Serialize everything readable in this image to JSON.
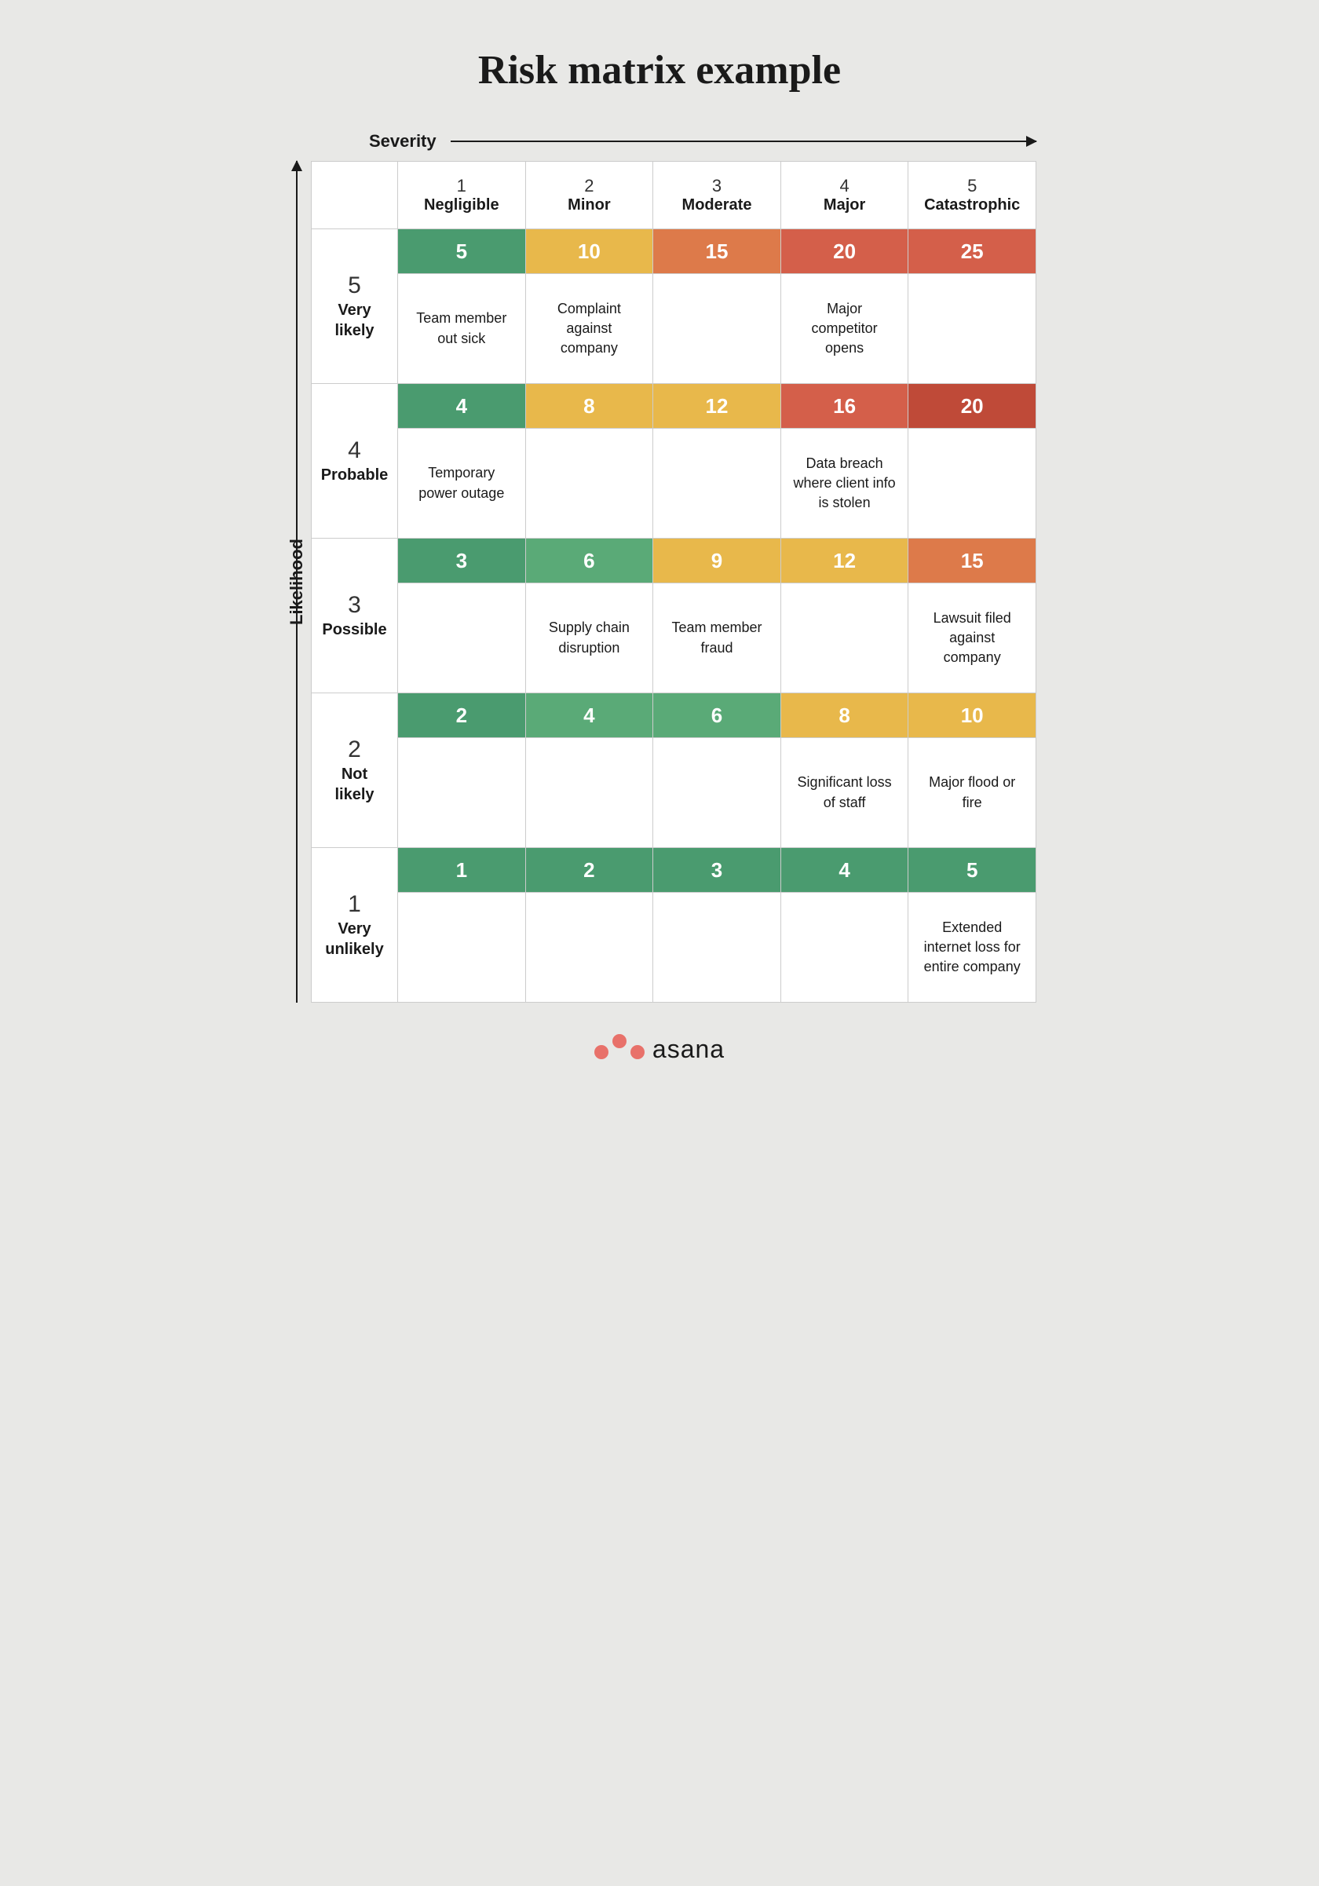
{
  "title": "Risk matrix example",
  "severity_label": "Severity",
  "likelihood_label": "Likelihood",
  "col_headers": [
    {
      "num": "1",
      "name": "Negligible"
    },
    {
      "num": "2",
      "name": "Minor"
    },
    {
      "num": "3",
      "name": "Moderate"
    },
    {
      "num": "4",
      "name": "Major"
    },
    {
      "num": "5",
      "name": "Catastrophic"
    }
  ],
  "rows": [
    {
      "likelihood_num": "5",
      "likelihood_name": "Very\nlikely",
      "scores": [
        {
          "value": "5",
          "color": "green-dark"
        },
        {
          "value": "10",
          "color": "yellow"
        },
        {
          "value": "15",
          "color": "orange"
        },
        {
          "value": "20",
          "color": "red"
        },
        {
          "value": "25",
          "color": "red"
        }
      ],
      "descriptions": [
        "Team member out sick",
        "Complaint against company",
        "",
        "Major competitor opens",
        ""
      ]
    },
    {
      "likelihood_num": "4",
      "likelihood_name": "Probable",
      "scores": [
        {
          "value": "4",
          "color": "green-dark"
        },
        {
          "value": "8",
          "color": "yellow"
        },
        {
          "value": "12",
          "color": "yellow"
        },
        {
          "value": "16",
          "color": "red"
        },
        {
          "value": "20",
          "color": "red-dark"
        }
      ],
      "descriptions": [
        "Temporary power outage",
        "",
        "",
        "Data breach where client info is stolen",
        ""
      ]
    },
    {
      "likelihood_num": "3",
      "likelihood_name": "Possible",
      "scores": [
        {
          "value": "3",
          "color": "green-dark"
        },
        {
          "value": "6",
          "color": "green-med"
        },
        {
          "value": "9",
          "color": "yellow"
        },
        {
          "value": "12",
          "color": "yellow"
        },
        {
          "value": "15",
          "color": "orange"
        }
      ],
      "descriptions": [
        "",
        "Supply chain disruption",
        "Team member fraud",
        "",
        "Lawsuit filed against company"
      ]
    },
    {
      "likelihood_num": "2",
      "likelihood_name": "Not\nlikely",
      "scores": [
        {
          "value": "2",
          "color": "green-dark"
        },
        {
          "value": "4",
          "color": "green-med"
        },
        {
          "value": "6",
          "color": "green-med"
        },
        {
          "value": "8",
          "color": "yellow"
        },
        {
          "value": "10",
          "color": "yellow"
        }
      ],
      "descriptions": [
        "",
        "",
        "",
        "Significant loss of staff",
        "Major flood or fire"
      ]
    },
    {
      "likelihood_num": "1",
      "likelihood_name": "Very\nunlikely",
      "scores": [
        {
          "value": "1",
          "color": "green-dark"
        },
        {
          "value": "2",
          "color": "green-dark"
        },
        {
          "value": "3",
          "color": "green-dark"
        },
        {
          "value": "4",
          "color": "green-dark"
        },
        {
          "value": "5",
          "color": "green-dark"
        }
      ],
      "descriptions": [
        "",
        "",
        "",
        "",
        "Extended internet loss for entire company"
      ]
    }
  ],
  "asana_label": "asana"
}
